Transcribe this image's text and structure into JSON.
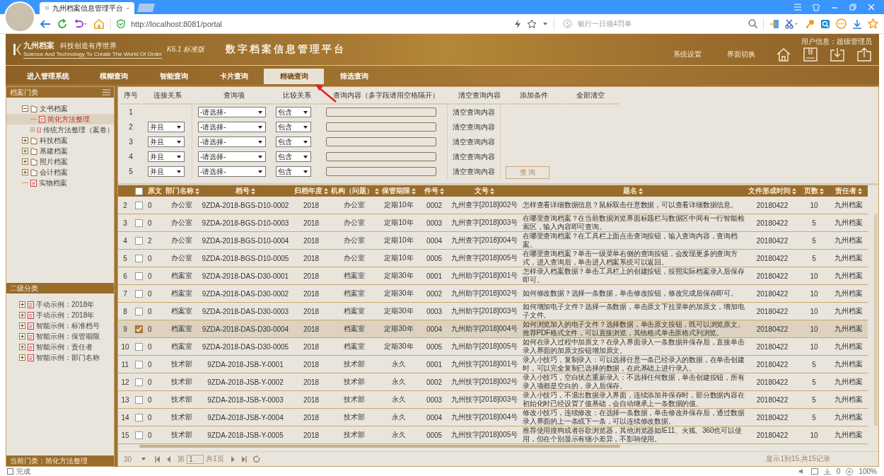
{
  "browser": {
    "tabs": [
      {
        "title": "九州档案信息管理平台",
        "selected": true
      }
    ],
    "url": "http://localhost:8081/portal",
    "search_placeholder": "银行一日领4罚单"
  },
  "app": {
    "logo_name": "九州档案",
    "logo_slogan": "科技创造有序世界",
    "logo_english": "Science And Technology To Create The World Of Order",
    "version": "K6.1 标准版",
    "title": "数字档案信息管理平台",
    "user_info": "用户信息：超级管理员",
    "header_links": [
      "系统设置",
      "界面切换"
    ]
  },
  "nav": [
    {
      "label": "进入管理系统",
      "selected": false
    },
    {
      "label": "模糊查询",
      "selected": false
    },
    {
      "label": "智能查询",
      "selected": false
    },
    {
      "label": "卡片查询",
      "selected": false
    },
    {
      "label": "精确查询",
      "selected": true
    },
    {
      "label": "筛选查询",
      "selected": false
    }
  ],
  "sidebar": {
    "title": "档案门类",
    "tree": [
      {
        "label": "文书档案",
        "kind": "folder",
        "expanded": true,
        "selected": false,
        "children": [
          {
            "label": "简化方法整理",
            "kind": "doc",
            "selected": true
          },
          {
            "label": "传统方法整理（案卷）",
            "kind": "doc",
            "expanded": false,
            "selected": false
          }
        ]
      },
      {
        "label": "科技档案",
        "kind": "folder",
        "expanded": false,
        "selected": false
      },
      {
        "label": "基建档案",
        "kind": "folder",
        "expanded": false,
        "selected": false
      },
      {
        "label": "照片档案",
        "kind": "folder",
        "expanded": false,
        "selected": false
      },
      {
        "label": "会计档案",
        "kind": "folder",
        "expanded": false,
        "selected": false
      },
      {
        "label": "实物档案",
        "kind": "doc",
        "selected": false
      }
    ],
    "section2_title": "二级分类",
    "section2_items": [
      {
        "label": "手动示例：2018年",
        "expanded": false
      },
      {
        "label": "手动示例：2018年",
        "expanded": false
      },
      {
        "label": "智能示例：标准档号",
        "expanded": false
      },
      {
        "label": "智能示例：保管期限",
        "expanded": false
      },
      {
        "label": "智能示例：责任者",
        "expanded": false
      },
      {
        "label": "智能示例：部门名称",
        "expanded": false
      }
    ],
    "current": "当前门类：简化方法整理"
  },
  "query": {
    "headers": [
      "序号",
      "连接关系",
      "查询项",
      "比较关系",
      "查询内容（多字段请用空格隔开）",
      "清空查询内容",
      "添加条件",
      "全部清空"
    ],
    "rows": [
      {
        "index": "1",
        "field": "-请选择-",
        "compare": "包含",
        "clear": "清空查询内容"
      },
      {
        "index": "2",
        "connector": "并且",
        "field": "-请选择-",
        "compare": "包含",
        "clear": "清空查询内容"
      },
      {
        "index": "3",
        "connector": "并且",
        "field": "-请选择-",
        "compare": "包含",
        "clear": "清空查询内容"
      },
      {
        "index": "4",
        "connector": "并且",
        "field": "-请选择-",
        "compare": "包含",
        "clear": "清空查询内容"
      },
      {
        "index": "5",
        "connector": "并且",
        "field": "-请选择-",
        "compare": "包含",
        "clear": "清空查询内容"
      }
    ],
    "button": "查 询"
  },
  "table": {
    "header_checked": false,
    "columns": [
      {
        "label": "原文",
        "sortable": false
      },
      {
        "label": "部门名称",
        "sortable": true
      },
      {
        "label": "档号",
        "sortable": true
      },
      {
        "label": "归档年度",
        "sortable": true
      },
      {
        "label": "机构（问题）",
        "sortable": true
      },
      {
        "label": "保管期限",
        "sortable": true
      },
      {
        "label": "件号",
        "sortable": true
      },
      {
        "label": "文号",
        "sortable": true
      },
      {
        "label": "题名",
        "sortable": true
      },
      {
        "label": "文件形成时间",
        "sortable": true
      },
      {
        "label": "页数",
        "sortable": true
      },
      {
        "label": "责任者",
        "sortable": true
      }
    ],
    "rows": [
      {
        "index": "2",
        "checked": false,
        "selected": false,
        "cells": [
          "0",
          "办公室",
          "9ZDA-2018-BGS-D10-0002",
          "2018",
          "办公室",
          "定期10年",
          "0002",
          "九州查字[2018]002号",
          "怎样查看详细数据信息？鼠标双击任意数据，可以查看详细数据信息。",
          "20180422",
          "10",
          "九州档案"
        ]
      },
      {
        "index": "3",
        "checked": false,
        "selected": false,
        "cells": [
          "0",
          "办公室",
          "9ZDA-2018-BGS-D10-0003",
          "2018",
          "办公室",
          "定期10年",
          "0003",
          "九州查字[2018]003号",
          "在哪里查询档案？在当前数据浏览界面标题栏与数据区中间有一行智能检索区，输入内容即可查询。",
          "20180422",
          "5",
          "九州档案"
        ]
      },
      {
        "index": "4",
        "checked": false,
        "selected": false,
        "cells": [
          "2",
          "办公室",
          "9ZDA-2018-BGS-D10-0004",
          "2018",
          "办公室",
          "定期10年",
          "0004",
          "九州查字[2018]004号",
          "在哪里查询档案？在工具栏上面点击查询按钮，输入查询内容，查询档案。",
          "20180422",
          "5",
          "九州档案"
        ]
      },
      {
        "index": "5",
        "checked": false,
        "selected": false,
        "cells": [
          "0",
          "办公室",
          "9ZDA-2018-BGS-D10-0005",
          "2018",
          "办公室",
          "定期10年",
          "0005",
          "九州查字[2018]005号",
          "在哪里查询档案？单击一级菜单右侧的查询按钮，会发现更多的查询方式，进入查询后，单击进入档案系统可以返回。",
          "20180422",
          "5",
          "九州档案"
        ]
      },
      {
        "index": "6",
        "checked": false,
        "selected": false,
        "cells": [
          "0",
          "档案室",
          "9ZDA-2018-DAS-D30-0001",
          "2018",
          "档案室",
          "定期30年",
          "0001",
          "九州助字[2018]001号",
          "怎样录入档案数据？单击工具栏上的创建按钮，按照实际档案录入后保存即可。",
          "20180422",
          "10",
          "九州档案"
        ]
      },
      {
        "index": "7",
        "checked": false,
        "selected": false,
        "cells": [
          "0",
          "档案室",
          "9ZDA-2018-DAS-D30-0002",
          "2018",
          "档案室",
          "定期30年",
          "0002",
          "九州助字[2018]002号",
          "如何修改数据？选择一条数据，单击修改按钮，修改完成后保存即可。",
          "20180422",
          "10",
          "九州档案"
        ]
      },
      {
        "index": "8",
        "checked": false,
        "selected": false,
        "cells": [
          "0",
          "档案室",
          "9ZDA-2018-DAS-D30-0003",
          "2018",
          "档案室",
          "定期30年",
          "0003",
          "九州助字[2018]003号",
          "如何增加电子文件？选择一条数据，单击原文下拉菜单的加原文，增加电子文件。",
          "20180422",
          "10",
          "九州档案"
        ]
      },
      {
        "index": "9",
        "checked": true,
        "selected": true,
        "cells": [
          "0",
          "档案室",
          "9ZDA-2018-DAS-D30-0004",
          "2018",
          "档案室",
          "定期30年",
          "0004",
          "九州助字[2018]004号",
          "如何浏览加入的电子文件？选择数据，单击原文按钮，既可以浏览原文。推荐PDF格式文件，可以直接浏览，其他格式单击原格式列浏览。",
          "20180422",
          "10",
          "九州档案"
        ]
      },
      {
        "index": "10",
        "checked": false,
        "selected": false,
        "cells": [
          "0",
          "档案室",
          "9ZDA-2018-DAS-D30-0005",
          "2018",
          "档案室",
          "定期30年",
          "0005",
          "九州助字[2018]005号",
          "如何在录入过程中加原文？在录入界面录入一条数据并保存后，直接单击录入界面的加原文按钮增加原文。",
          "20180422",
          "10",
          "九州档案"
        ]
      },
      {
        "index": "11",
        "checked": false,
        "selected": false,
        "cells": [
          "0",
          "技术部",
          "9ZDA-2018-JSB-Y-0001",
          "2018",
          "技术部",
          "永久",
          "0001",
          "九州技字[2018]001号",
          "录入小技巧，复制录入：可以选择任意一条已经录入的数据，在单击创建时，可以完全复制已选择的数据，在此基础上进行录入。",
          "20180422",
          "5",
          "九州档案"
        ]
      },
      {
        "index": "12",
        "checked": false,
        "selected": false,
        "cells": [
          "0",
          "技术部",
          "9ZDA-2018-JSB-Y-0002",
          "2018",
          "技术部",
          "永久",
          "0002",
          "九州技字[2018]002号",
          "录入小技巧，空白状态重新录入：不选择任何数据，单击创建按钮，所有录入项都是空白的，录入后保存。",
          "20180422",
          "5",
          "九州档案"
        ]
      },
      {
        "index": "13",
        "checked": false,
        "selected": false,
        "cells": [
          "0",
          "技术部",
          "9ZDA-2018-JSB-Y-0003",
          "2018",
          "技术部",
          "永久",
          "0003",
          "九州技字[2018]003号",
          "录入小技巧，不退出数据录入界面，连续添加并保存时，部分数据内容在初始化时已经设置了值基础，会自动继承上一条数据的值。",
          "20180422",
          "5",
          "九州档案"
        ]
      },
      {
        "index": "14",
        "checked": false,
        "selected": false,
        "cells": [
          "0",
          "技术部",
          "9ZDA-2018-JSB-Y-0004",
          "2018",
          "技术部",
          "永久",
          "0004",
          "九州技字[2018]004号",
          "修改小技巧，连续修改：在选择一条数据，单击修改并保存后，通过数据录入界面的上一条或下一条，可以连续修改数据。",
          "20180422",
          "5",
          "九州档案"
        ]
      },
      {
        "index": "15",
        "checked": false,
        "selected": false,
        "cells": [
          "0",
          "技术部",
          "9ZDA-2018-JSB-Y-0005",
          "2018",
          "技术部",
          "永久",
          "0005",
          "九州技字[2018]005号",
          "推荐使用搜狗或者谷歌浏览器，其他浏览器如IE11、火狐、360也可以使用，但在个别显示有细小差异，不影响使用。",
          "20180422",
          "10",
          "九州档案"
        ]
      }
    ]
  },
  "pager": {
    "page_size": "30",
    "before": "第",
    "page": "1",
    "after": "共1页",
    "summary": "显示1到15,共15记录"
  },
  "status_bar": {
    "text": "完成",
    "count": "0",
    "zoom": "100%"
  }
}
